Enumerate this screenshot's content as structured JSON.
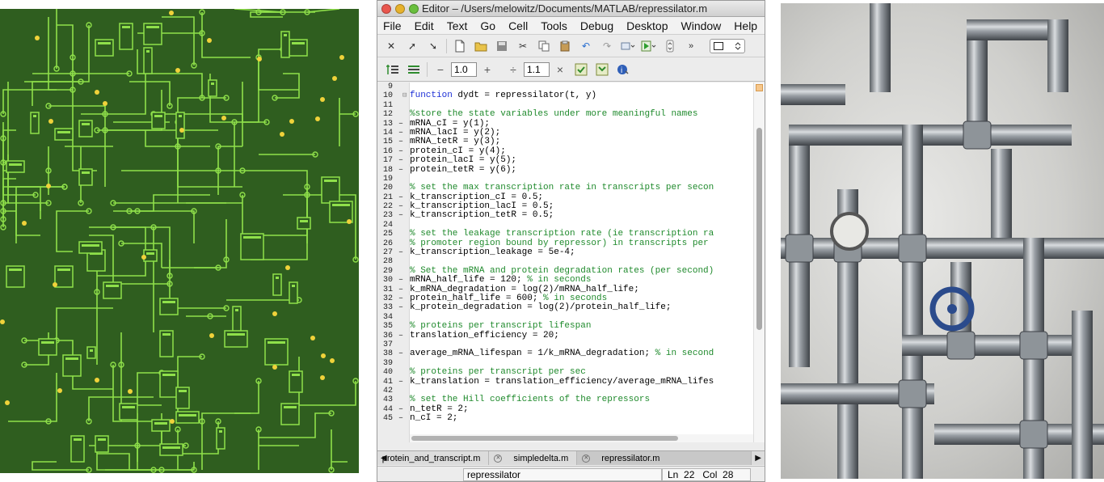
{
  "window": {
    "title": "Editor – /Users/melowitz/Documents/MATLAB/repressilator.m"
  },
  "menu": [
    "File",
    "Edit",
    "Text",
    "Go",
    "Cell",
    "Tools",
    "Debug",
    "Desktop",
    "Window",
    "Help"
  ],
  "toolbar2": {
    "cell_value_1": "1.0",
    "cell_value_2": "1.1",
    "minus": "−",
    "plus": "+",
    "divide": "÷",
    "times": "×"
  },
  "code_lines": [
    {
      "n": "9",
      "dash": "",
      "text": "",
      "type": "code"
    },
    {
      "n": "10",
      "dash": "",
      "kw": "function",
      "text": " dydt = repressilator(t, y)",
      "type": "func"
    },
    {
      "n": "11",
      "dash": "",
      "text": "",
      "type": "code"
    },
    {
      "n": "12",
      "dash": "",
      "text": "%store the state variables under more meaningful names",
      "type": "comment"
    },
    {
      "n": "13",
      "dash": "–",
      "text": "mRNA_cI = y(1);",
      "type": "code"
    },
    {
      "n": "14",
      "dash": "–",
      "text": "mRNA_lacI = y(2);",
      "type": "code"
    },
    {
      "n": "15",
      "dash": "–",
      "text": "mRNA_tetR = y(3);",
      "type": "code"
    },
    {
      "n": "16",
      "dash": "–",
      "text": "protein_cI = y(4);",
      "type": "code"
    },
    {
      "n": "17",
      "dash": "–",
      "text": "protein_lacI = y(5);",
      "type": "code"
    },
    {
      "n": "18",
      "dash": "–",
      "text": "protein_tetR = y(6);",
      "type": "code"
    },
    {
      "n": "19",
      "dash": "",
      "text": "",
      "type": "code"
    },
    {
      "n": "20",
      "dash": "",
      "text": "% set the max transcription rate in transcripts per secon",
      "type": "comment"
    },
    {
      "n": "21",
      "dash": "–",
      "text": "k_transcription_cI = 0.5;",
      "type": "code"
    },
    {
      "n": "22",
      "dash": "–",
      "text": "k_transcription_lacI = 0.5;",
      "type": "code"
    },
    {
      "n": "23",
      "dash": "–",
      "text": "k_transcription_tetR = 0.5;",
      "type": "code"
    },
    {
      "n": "24",
      "dash": "",
      "text": "",
      "type": "code"
    },
    {
      "n": "25",
      "dash": "",
      "text": "% set the leakage transcription rate (ie transcription ra",
      "type": "comment"
    },
    {
      "n": "26",
      "dash": "",
      "text": "% promoter region bound by repressor) in transcripts per",
      "type": "comment"
    },
    {
      "n": "27",
      "dash": "–",
      "text": "k_transcription_leakage = 5e-4;",
      "type": "code"
    },
    {
      "n": "28",
      "dash": "",
      "text": "",
      "type": "code"
    },
    {
      "n": "29",
      "dash": "",
      "text": "% Set the mRNA and protein degradation rates (per second)",
      "type": "comment"
    },
    {
      "n": "30",
      "dash": "–",
      "text": "mRNA_half_life = 120; ",
      "tail": "% in seconds",
      "type": "mixed"
    },
    {
      "n": "31",
      "dash": "–",
      "text": "k_mRNA_degradation = log(2)/mRNA_half_life;",
      "type": "code"
    },
    {
      "n": "32",
      "dash": "–",
      "text": "protein_half_life = 600; ",
      "tail": "% in seconds",
      "type": "mixed"
    },
    {
      "n": "33",
      "dash": "–",
      "text": "k_protein_degradation = log(2)/protein_half_life;",
      "type": "code"
    },
    {
      "n": "34",
      "dash": "",
      "text": "",
      "type": "code"
    },
    {
      "n": "35",
      "dash": "",
      "text": "% proteins per transcript lifespan",
      "type": "comment"
    },
    {
      "n": "36",
      "dash": "–",
      "text": "translation_efficiency = 20;",
      "type": "code"
    },
    {
      "n": "37",
      "dash": "",
      "text": "",
      "type": "code"
    },
    {
      "n": "38",
      "dash": "–",
      "text": "average_mRNA_lifespan = 1/k_mRNA_degradation; ",
      "tail": "% in second",
      "type": "mixed"
    },
    {
      "n": "39",
      "dash": "",
      "text": "",
      "type": "code"
    },
    {
      "n": "40",
      "dash": "",
      "text": "% proteins per transcript per sec",
      "type": "comment"
    },
    {
      "n": "41",
      "dash": "–",
      "text": "k_translation = translation_efficiency/average_mRNA_lifes",
      "type": "code"
    },
    {
      "n": "42",
      "dash": "",
      "text": "",
      "type": "code"
    },
    {
      "n": "43",
      "dash": "",
      "text": "% set the Hill coefficients of the repressors",
      "type": "comment"
    },
    {
      "n": "44",
      "dash": "–",
      "text": "n_tetR = 2;",
      "type": "code"
    },
    {
      "n": "45",
      "dash": "–",
      "text": "n_cI = 2;",
      "type": "code"
    }
  ],
  "tabs": [
    {
      "label": "protein_and_transcript.m"
    },
    {
      "label": "simpledelta.m"
    },
    {
      "label": "repressilator.m"
    }
  ],
  "status": {
    "function": "repressilator",
    "position": "Ln  22   Col  28"
  },
  "colors": {
    "comment": "#1f8a2c",
    "keyword": "#1c2fd6",
    "circuit_bg": "#2f5e1f",
    "trace": "#8fe04a"
  }
}
